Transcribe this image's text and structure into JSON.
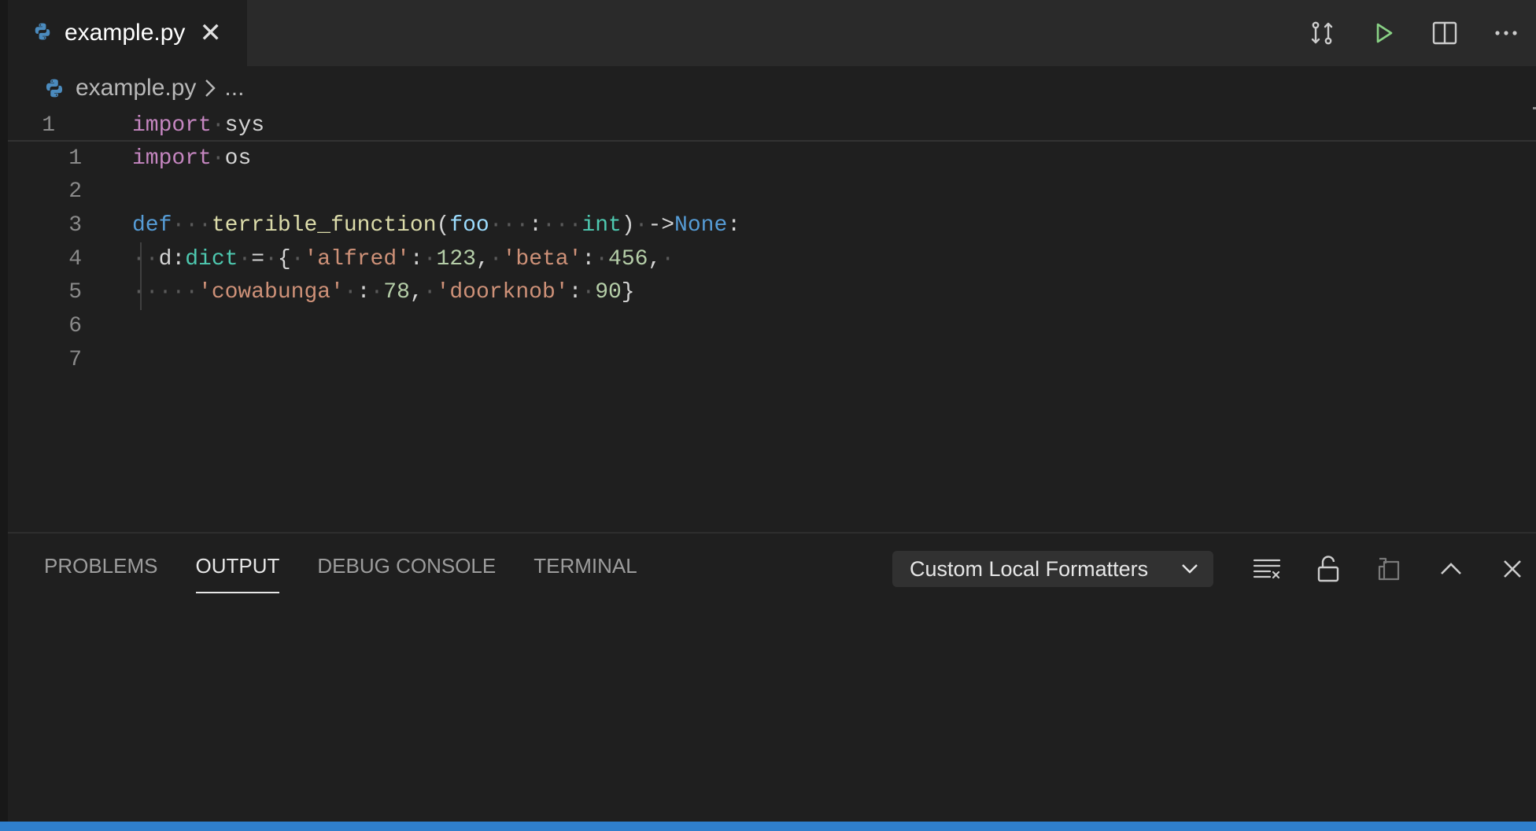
{
  "tab": {
    "label": "example.py",
    "close_glyph": "✕",
    "icon": "python-file-icon"
  },
  "editor_actions": [
    {
      "name": "open-changes-icon"
    },
    {
      "name": "run-python-file-icon"
    },
    {
      "name": "split-editor-icon"
    },
    {
      "name": "more-actions-icon"
    }
  ],
  "breadcrumb": {
    "file": "example.py",
    "symbol": "..."
  },
  "sticky": {
    "line_number": "1",
    "code": "import sys"
  },
  "lines": [
    {
      "n": "1"
    },
    {
      "n": "2"
    },
    {
      "n": "3"
    },
    {
      "n": "4"
    },
    {
      "n": "5"
    },
    {
      "n": "6"
    },
    {
      "n": "7"
    }
  ],
  "panel": {
    "tabs": [
      "PROBLEMS",
      "OUTPUT",
      "DEBUG CONSOLE",
      "TERMINAL"
    ],
    "active_tab": "OUTPUT",
    "output_channel": "Custom Local Formatters"
  },
  "colors": {
    "keyword": "#c586c0",
    "def_keyword": "#569cd6",
    "function": "#dcdcaa",
    "string": "#ce9178",
    "number": "#b5cea8",
    "type": "#4ec9b0",
    "status_bar": "#2f7fcc"
  }
}
